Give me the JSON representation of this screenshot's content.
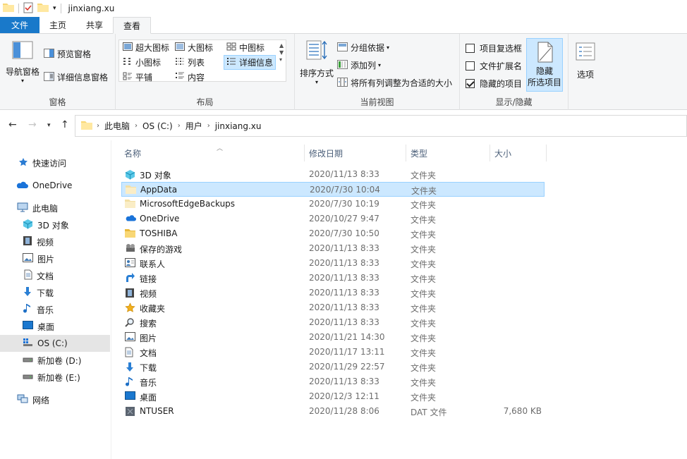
{
  "window": {
    "title": "jinxiang.xu"
  },
  "tabs": [
    {
      "label": "文件"
    },
    {
      "label": "主页"
    },
    {
      "label": "共享"
    },
    {
      "label": "查看"
    }
  ],
  "ribbon": {
    "panes": {
      "nav_pane": "导航窗格",
      "preview_pane": "预览窗格",
      "details_pane": "详细信息窗格",
      "label": "窗格"
    },
    "layout": {
      "items": [
        "超大图标",
        "大图标",
        "中图标",
        "小图标",
        "列表",
        "详细信息",
        "平铺",
        "内容"
      ],
      "label": "布局"
    },
    "current_view": {
      "sort_by": "排序方式",
      "group_by": "分组依据",
      "add_column": "添加列",
      "fit_columns": "将所有列调整为合适的大小",
      "label": "当前视图"
    },
    "show_hide": {
      "item_checkboxes": "项目复选框",
      "file_extensions": "文件扩展名",
      "hidden_items": "隐藏的项目",
      "hide_selected_1": "隐藏",
      "hide_selected_2": "所选项目",
      "label": "显示/隐藏"
    },
    "options": "选项"
  },
  "address": {
    "crumbs": [
      "此电脑",
      "OS (C:)",
      "用户",
      "jinxiang.xu"
    ]
  },
  "nav": [
    {
      "label": "快速访问"
    },
    {
      "label": "OneDrive"
    },
    {
      "label": "此电脑"
    },
    {
      "label": "3D 对象"
    },
    {
      "label": "视频"
    },
    {
      "label": "图片"
    },
    {
      "label": "文档"
    },
    {
      "label": "下载"
    },
    {
      "label": "音乐"
    },
    {
      "label": "桌面"
    },
    {
      "label": "OS (C:)"
    },
    {
      "label": "新加卷 (D:)"
    },
    {
      "label": "新加卷 (E:)"
    },
    {
      "label": "网络"
    }
  ],
  "columns": {
    "name": "名称",
    "date": "修改日期",
    "type": "类型",
    "size": "大小"
  },
  "files": [
    {
      "name": "3D 对象",
      "date": "2020/11/13 8:33",
      "type": "文件夹",
      "size": ""
    },
    {
      "name": "AppData",
      "date": "2020/7/30 10:04",
      "type": "文件夹",
      "size": ""
    },
    {
      "name": "MicrosoftEdgeBackups",
      "date": "2020/7/30 10:19",
      "type": "文件夹",
      "size": ""
    },
    {
      "name": "OneDrive",
      "date": "2020/10/27 9:47",
      "type": "文件夹",
      "size": ""
    },
    {
      "name": "TOSHIBA",
      "date": "2020/7/30 10:50",
      "type": "文件夹",
      "size": ""
    },
    {
      "name": "保存的游戏",
      "date": "2020/11/13 8:33",
      "type": "文件夹",
      "size": ""
    },
    {
      "name": "联系人",
      "date": "2020/11/13 8:33",
      "type": "文件夹",
      "size": ""
    },
    {
      "name": "链接",
      "date": "2020/11/13 8:33",
      "type": "文件夹",
      "size": ""
    },
    {
      "name": "视频",
      "date": "2020/11/13 8:33",
      "type": "文件夹",
      "size": ""
    },
    {
      "name": "收藏夹",
      "date": "2020/11/13 8:33",
      "type": "文件夹",
      "size": ""
    },
    {
      "name": "搜索",
      "date": "2020/11/13 8:33",
      "type": "文件夹",
      "size": ""
    },
    {
      "name": "图片",
      "date": "2020/11/21 14:30",
      "type": "文件夹",
      "size": ""
    },
    {
      "name": "文档",
      "date": "2020/11/17 13:11",
      "type": "文件夹",
      "size": ""
    },
    {
      "name": "下载",
      "date": "2020/11/29 22:57",
      "type": "文件夹",
      "size": ""
    },
    {
      "name": "音乐",
      "date": "2020/11/13 8:33",
      "type": "文件夹",
      "size": ""
    },
    {
      "name": "桌面",
      "date": "2020/12/3 12:11",
      "type": "文件夹",
      "size": ""
    },
    {
      "name": "NTUSER",
      "date": "2020/11/28 8:06",
      "type": "DAT 文件",
      "size": "7,680 KB"
    }
  ]
}
